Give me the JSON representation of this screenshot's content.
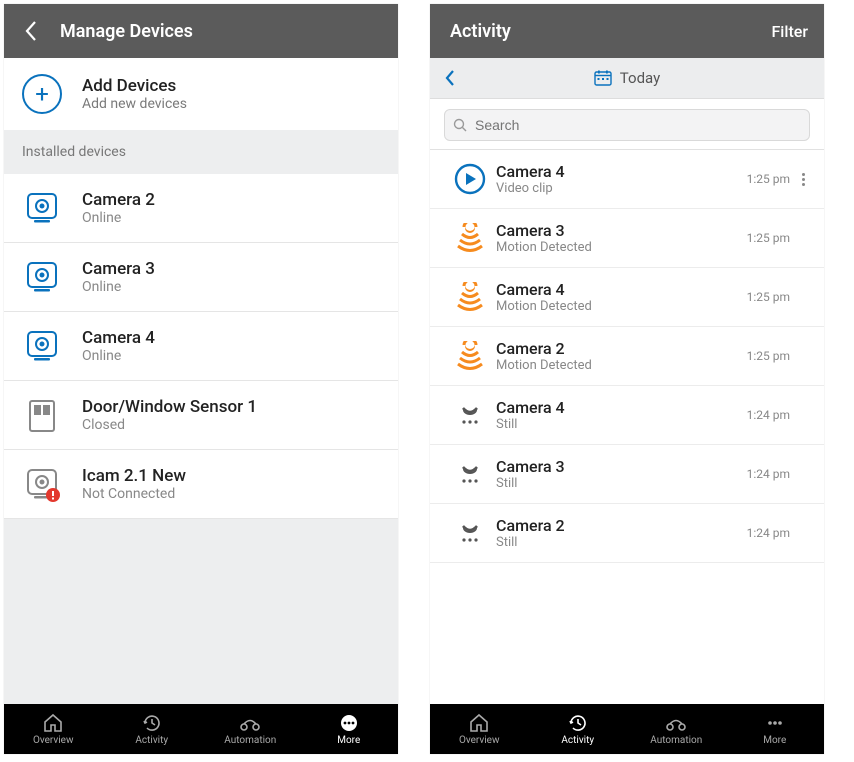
{
  "colors": {
    "accent": "#0a72bd",
    "warn": "#f68b1e",
    "error": "#e3382d"
  },
  "left": {
    "header_title": "Manage Devices",
    "add": {
      "title": "Add Devices",
      "subtitle": "Add new devices"
    },
    "section_label": "Installed devices",
    "devices": [
      {
        "name": "Camera 2",
        "status": "Online",
        "icon": "camera-online"
      },
      {
        "name": "Camera 3",
        "status": "Online",
        "icon": "camera-online"
      },
      {
        "name": "Camera 4",
        "status": "Online",
        "icon": "camera-online"
      },
      {
        "name": "Door/Window Sensor 1",
        "status": "Closed",
        "icon": "door-sensor"
      },
      {
        "name": "Icam 2.1 New",
        "status": "Not Connected",
        "icon": "camera-error"
      }
    ],
    "tabs": [
      {
        "label": "Overview",
        "icon": "home"
      },
      {
        "label": "Activity",
        "icon": "clock"
      },
      {
        "label": "Automation",
        "icon": "automation"
      },
      {
        "label": "More",
        "icon": "more"
      }
    ],
    "active_tab": 3
  },
  "right": {
    "header_title": "Activity",
    "filter_label": "Filter",
    "day_label": "Today",
    "search_placeholder": "Search",
    "events": [
      {
        "name": "Camera 4",
        "detail": "Video clip",
        "time": "1:25 pm",
        "icon": "play",
        "has_more": true
      },
      {
        "name": "Camera 3",
        "detail": "Motion Detected",
        "time": "1:25 pm",
        "icon": "motion",
        "has_more": false
      },
      {
        "name": "Camera 4",
        "detail": "Motion Detected",
        "time": "1:25 pm",
        "icon": "motion",
        "has_more": false
      },
      {
        "name": "Camera 2",
        "detail": "Motion Detected",
        "time": "1:25 pm",
        "icon": "motion",
        "has_more": false
      },
      {
        "name": "Camera 4",
        "detail": "Still",
        "time": "1:24 pm",
        "icon": "still",
        "has_more": false
      },
      {
        "name": "Camera 3",
        "detail": "Still",
        "time": "1:24 pm",
        "icon": "still",
        "has_more": false
      },
      {
        "name": "Camera 2",
        "detail": "Still",
        "time": "1:24 pm",
        "icon": "still",
        "has_more": false
      }
    ],
    "tabs": [
      {
        "label": "Overview",
        "icon": "home"
      },
      {
        "label": "Activity",
        "icon": "clock"
      },
      {
        "label": "Automation",
        "icon": "automation"
      },
      {
        "label": "More",
        "icon": "more"
      }
    ],
    "active_tab": 1
  }
}
